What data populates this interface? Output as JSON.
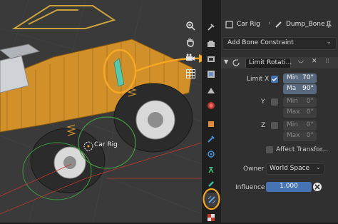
{
  "panel": {
    "object_name": "Car Rig",
    "bone_name": "Dump_Bone",
    "add_constraint_label": "Add Bone Constraint",
    "constraint_name": "Limit Rotati...",
    "limit_x_label": "Limit X",
    "limit_y_label": "Y",
    "limit_z_label": "Z",
    "min_label": "Min",
    "max_label": "Max",
    "min_abbr": "Ma",
    "x_min": "70°",
    "x_max": "90°",
    "y_min": "0°",
    "y_max": "0°",
    "z_min": "0°",
    "z_max": "0°",
    "affect_transform_label": "Affect Transfor...",
    "owner_label": "Owner",
    "owner_value": "World Space",
    "influence_label": "Influence",
    "influence_value": "1.000",
    "influence_fraction": 1.0
  },
  "viewport": {
    "bone_label": "Car Rig"
  },
  "colors": {
    "accent": "#4772b3",
    "annotation": "#f5a623",
    "truck": "#d99a2e"
  },
  "icons": [
    "search-icon",
    "zoom-icon",
    "hand-icon",
    "camera-icon",
    "grid-icon",
    "tool-icon",
    "render-icon",
    "output-icon",
    "view-layer-icon",
    "scene-icon",
    "world-icon",
    "object-icon",
    "modifier-icon",
    "particles-icon",
    "physics-icon",
    "constraint-icon",
    "data-icon",
    "bone-icon",
    "bone-constraint-icon",
    "texture-icon"
  ]
}
